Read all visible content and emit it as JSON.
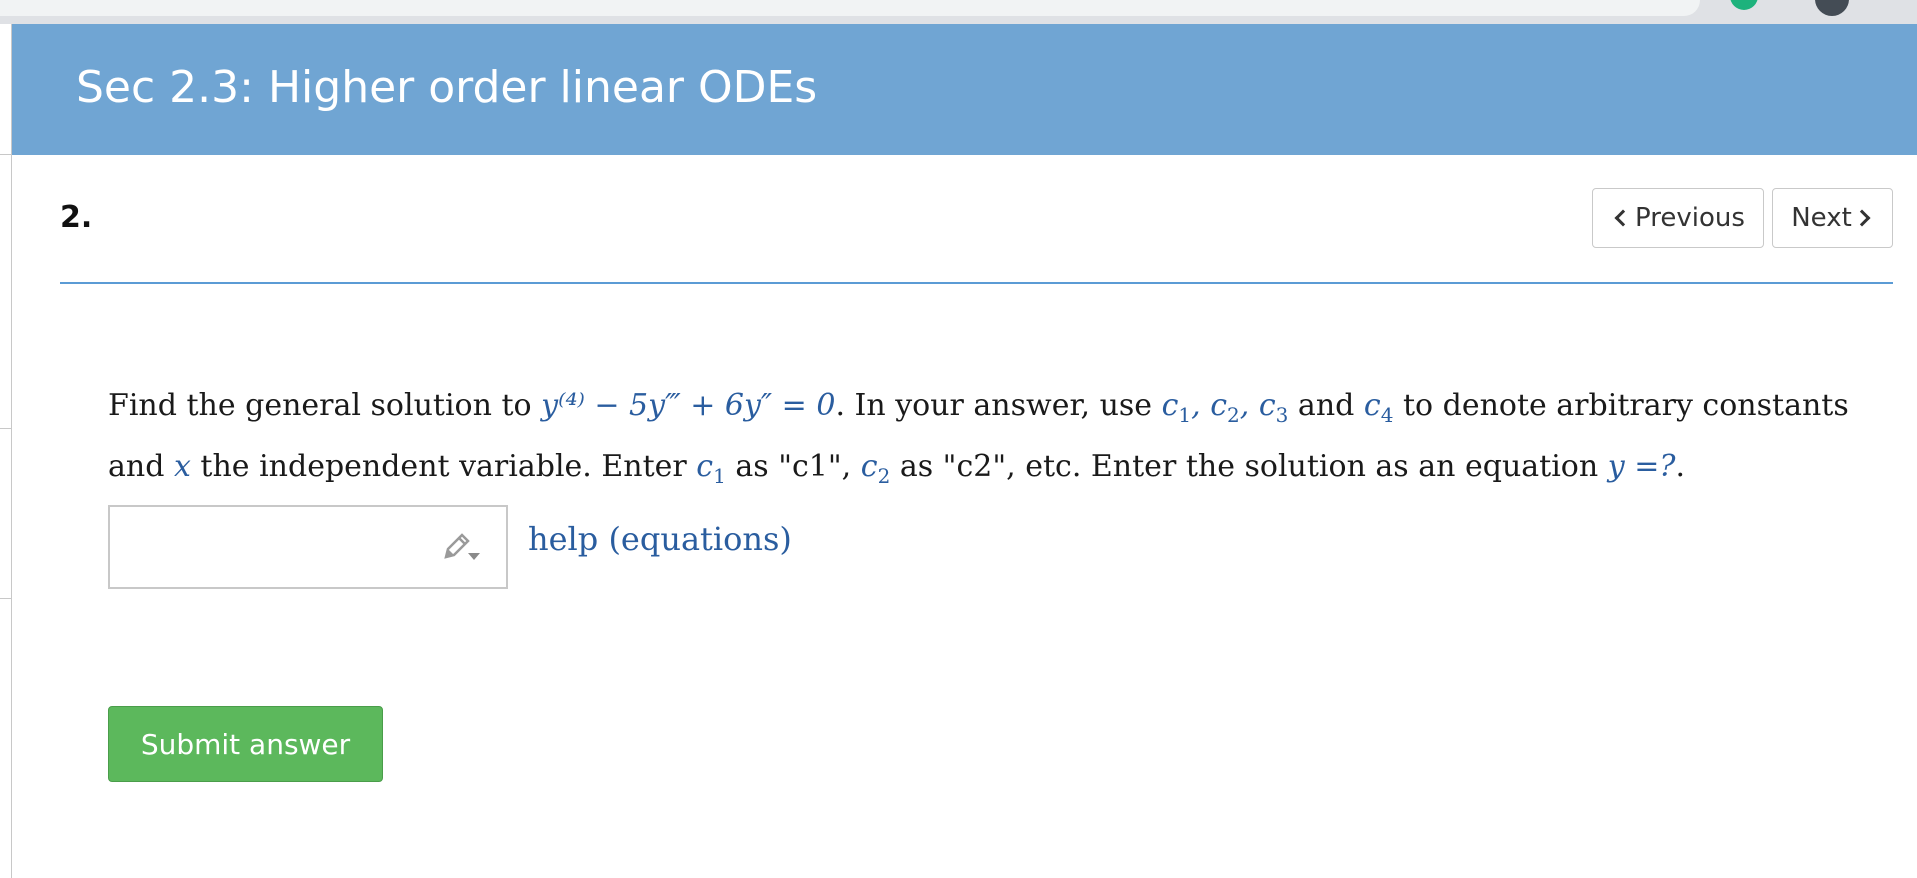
{
  "page": {
    "section_title": "Sec 2.3: Higher order linear ODEs",
    "problem_number": "2."
  },
  "nav": {
    "previous_label": "Previous",
    "next_label": "Next"
  },
  "question": {
    "t1": "Find the general solution to ",
    "eq_main": "y⁽⁴⁾ − 5y‴ + 6y″ = 0",
    "t2": ". In your answer, use ",
    "c1": "c",
    "c1_sub": "1",
    "comma1": ", ",
    "c2": "c",
    "c2_sub": "2",
    "comma2": ", ",
    "c3": "c",
    "c3_sub": "3",
    "t3": " and ",
    "c4": "c",
    "c4_sub": "4",
    "t4": " to denote arbitrary constants and ",
    "var_x": "x",
    "t5": " the independent variable. Enter ",
    "e1": "c",
    "e1_sub": "1",
    "t6": " as \"c1\", ",
    "e2": "c",
    "e2_sub": "2",
    "t7": " as \"c2\", etc. Enter the solution as an equation ",
    "eq_y": "y =?",
    "t8": "."
  },
  "answer": {
    "value": "",
    "placeholder": ""
  },
  "help": {
    "label": "help (equations)"
  },
  "actions": {
    "submit_label": "Submit answer"
  },
  "colors": {
    "header_bg": "#70a5d3",
    "math_blue": "#2a5d9f",
    "submit_green": "#5cb85c",
    "divider_blue": "#5b9bd5"
  },
  "icons": {
    "pencil": "pencil-icon",
    "chevron_left": "chevron-left-icon",
    "chevron_right": "chevron-right-icon"
  }
}
